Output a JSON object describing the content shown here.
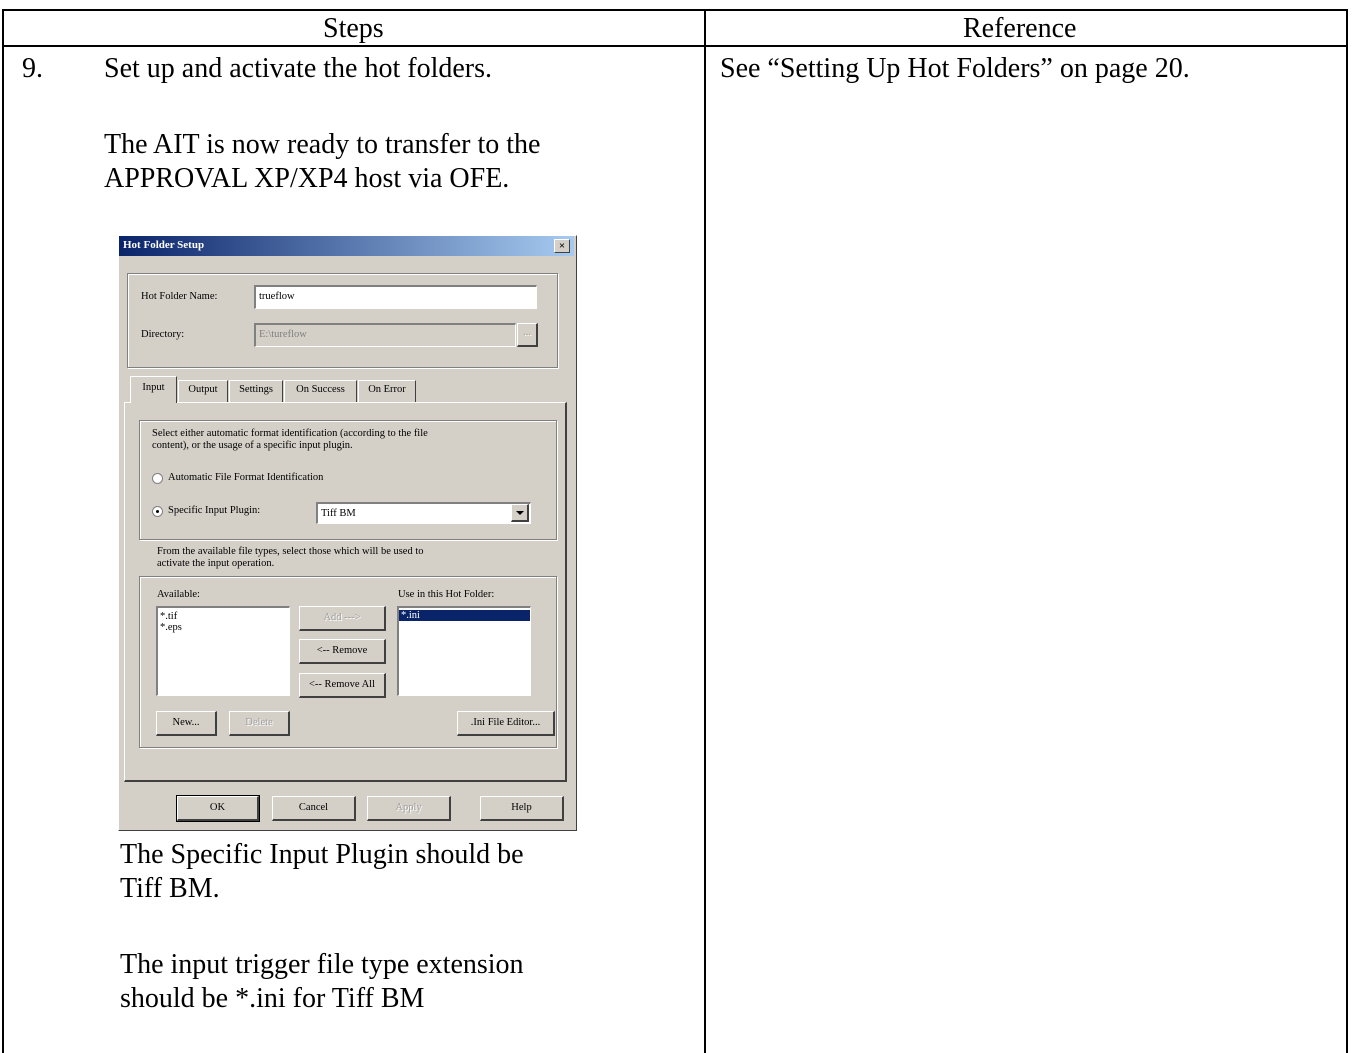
{
  "table": {
    "header_steps": "Steps",
    "header_reference": "Reference",
    "step_number": "9.",
    "step_main": "Set up and activate the hot folders.",
    "step_para_line1": "The AIT is now ready to transfer to the",
    "step_para_line2": "APPROVAL XP/XP4 host via OFE.",
    "note1_line1": "The Specific Input Plugin should be",
    "note1_line2": "Tiff BM.",
    "note2_line1": "The input trigger file type extension",
    "note2_line2": "should be *.ini for Tiff BM",
    "reference_text": "See “Setting Up Hot Folders” on page 20."
  },
  "dialog": {
    "title": "Hot Folder Setup",
    "close_glyph": "×",
    "hot_folder_name_label": "Hot Folder Name:",
    "hot_folder_name_value": "trueflow",
    "directory_label": "Directory:",
    "directory_value": "E:\\tureflow",
    "browse_label": "...",
    "tabs": [
      "Input",
      "Output",
      "Settings",
      "On Success",
      "On Error"
    ],
    "active_tab": "Input",
    "format_desc_line1": "Select either automatic format identification (according to the file",
    "format_desc_line2": "content), or the usage of a specific input plugin.",
    "radio_auto_label": "Automatic File Format Identification",
    "radio_specific_label": "Specific Input Plugin:",
    "selected_radio": "specific",
    "plugin_value": "Tiff BM",
    "filetypes_desc_line1": "From the available file types, select those which will be used to",
    "filetypes_desc_line2": "activate the input operation.",
    "available_label": "Available:",
    "available_items": [
      "*.tif",
      "*.eps"
    ],
    "use_label": "Use in this Hot Folder:",
    "use_items": [
      "*.ini"
    ],
    "add_button": "Add --->",
    "remove_button": "<-- Remove",
    "remove_all_button": "<-- Remove All",
    "new_button": "New...",
    "delete_button": "Delete",
    "ini_editor_button": ".Ini File Editor...",
    "ok_button": "OK",
    "cancel_button": "Cancel",
    "apply_button": "Apply",
    "help_button": "Help"
  },
  "colors": {
    "dialog_face": "#d4d0c8",
    "title_start": "#0a246a",
    "title_end": "#a6caf0",
    "selection": "#0a246a"
  }
}
